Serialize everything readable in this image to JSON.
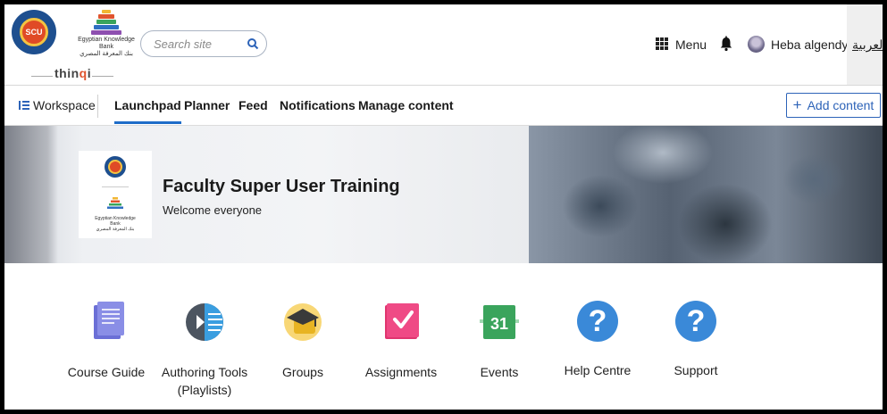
{
  "header": {
    "scu_logo_text": "SCU",
    "ekb_logo_text_en": "Egyptian Knowledge Bank",
    "ekb_logo_text_ar": "بنك المعرفة المصري",
    "brand": "thin",
    "brand_q": "q",
    "brand_i": "i",
    "search_placeholder": "Search site",
    "menu_label": "Menu",
    "user_name": "Heba algendy",
    "user_caret": "▾",
    "language_link": "العربية"
  },
  "nav": {
    "workspace_label": "Workspace",
    "tabs": [
      {
        "label": "Launchpad",
        "active": true
      },
      {
        "label": "Planner",
        "active": false
      },
      {
        "label": "Feed",
        "active": false
      },
      {
        "label": "Notifications",
        "active": false
      },
      {
        "label": "Manage content",
        "active": false
      }
    ],
    "add_content_plus": "+",
    "add_content_label": "Add content"
  },
  "banner": {
    "title": "Faculty Super User Training",
    "subtitle": "Welcome everyone",
    "card_ekb_en": "Egyptian Knowledge Bank",
    "card_ekb_ar": "بنك المعرفة المصري"
  },
  "apps": [
    {
      "label": "Course Guide",
      "icon": "course-guide-icon"
    },
    {
      "label": "Authoring Tools (Playlists)",
      "icon": "authoring-tools-icon"
    },
    {
      "label": "Groups",
      "icon": "groups-icon"
    },
    {
      "label": "Assignments",
      "icon": "assignments-icon"
    },
    {
      "label": "Events",
      "icon": "events-icon",
      "number": "31"
    },
    {
      "label": "Help Centre",
      "icon": "help-icon",
      "glyph": "?"
    },
    {
      "label": "Support",
      "icon": "support-icon",
      "glyph": "?"
    }
  ],
  "colors": {
    "accent": "#2d63b8",
    "active_tab": "#1e6cc8",
    "help_blue": "#3a89d8",
    "assignments_pink": "#e0356f",
    "events_green": "#3aa45c",
    "groups_yellow": "#f2c130",
    "course_guide_purple": "#6b6fd6"
  }
}
